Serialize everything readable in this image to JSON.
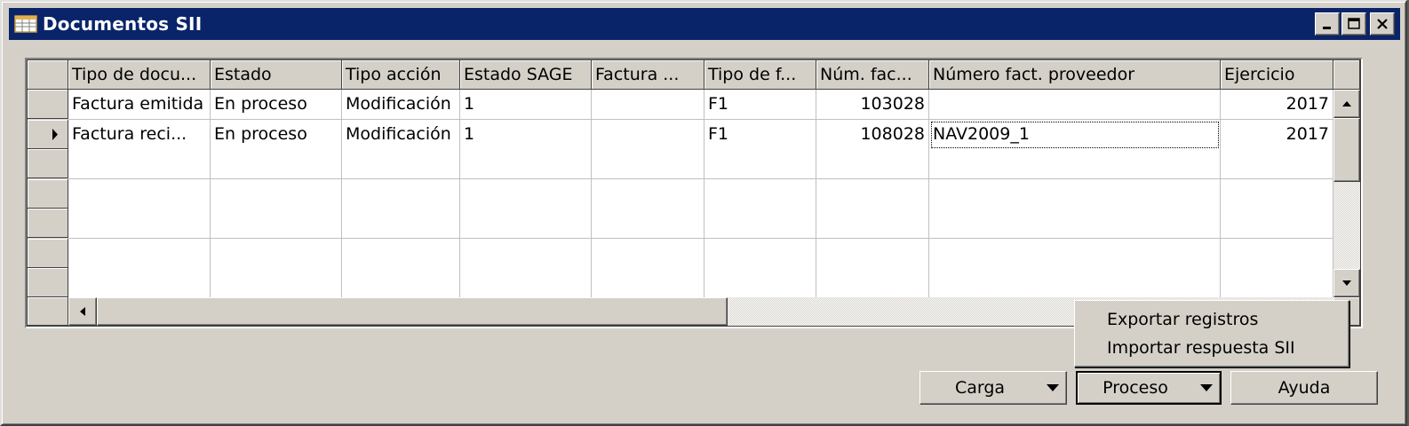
{
  "window": {
    "title": "Documentos SII"
  },
  "grid": {
    "columns": [
      {
        "label": "Tipo de docu..."
      },
      {
        "label": "Estado"
      },
      {
        "label": "Tipo acción"
      },
      {
        "label": "Estado SAGE"
      },
      {
        "label": "Factura ..."
      },
      {
        "label": "Tipo de f..."
      },
      {
        "label": "Núm. fac..."
      },
      {
        "label": "Número fact. proveedor"
      },
      {
        "label": "Ejercicio"
      }
    ],
    "rows": [
      {
        "cells": [
          "Factura emitida",
          "En proceso",
          "Modificación",
          "1",
          "",
          "F1",
          "103028",
          "",
          "2017"
        ]
      },
      {
        "cells": [
          "Factura reci...",
          "En proceso",
          "Modificación",
          "1",
          "",
          "F1",
          "108028",
          "NAV2009_1",
          "2017"
        ]
      }
    ]
  },
  "menu": {
    "items": [
      {
        "label": "Exportar registros"
      },
      {
        "label": "Importar respuesta SII"
      }
    ]
  },
  "buttons": {
    "carga": "Carga",
    "proceso": "Proceso",
    "ayuda": "Ayuda"
  }
}
